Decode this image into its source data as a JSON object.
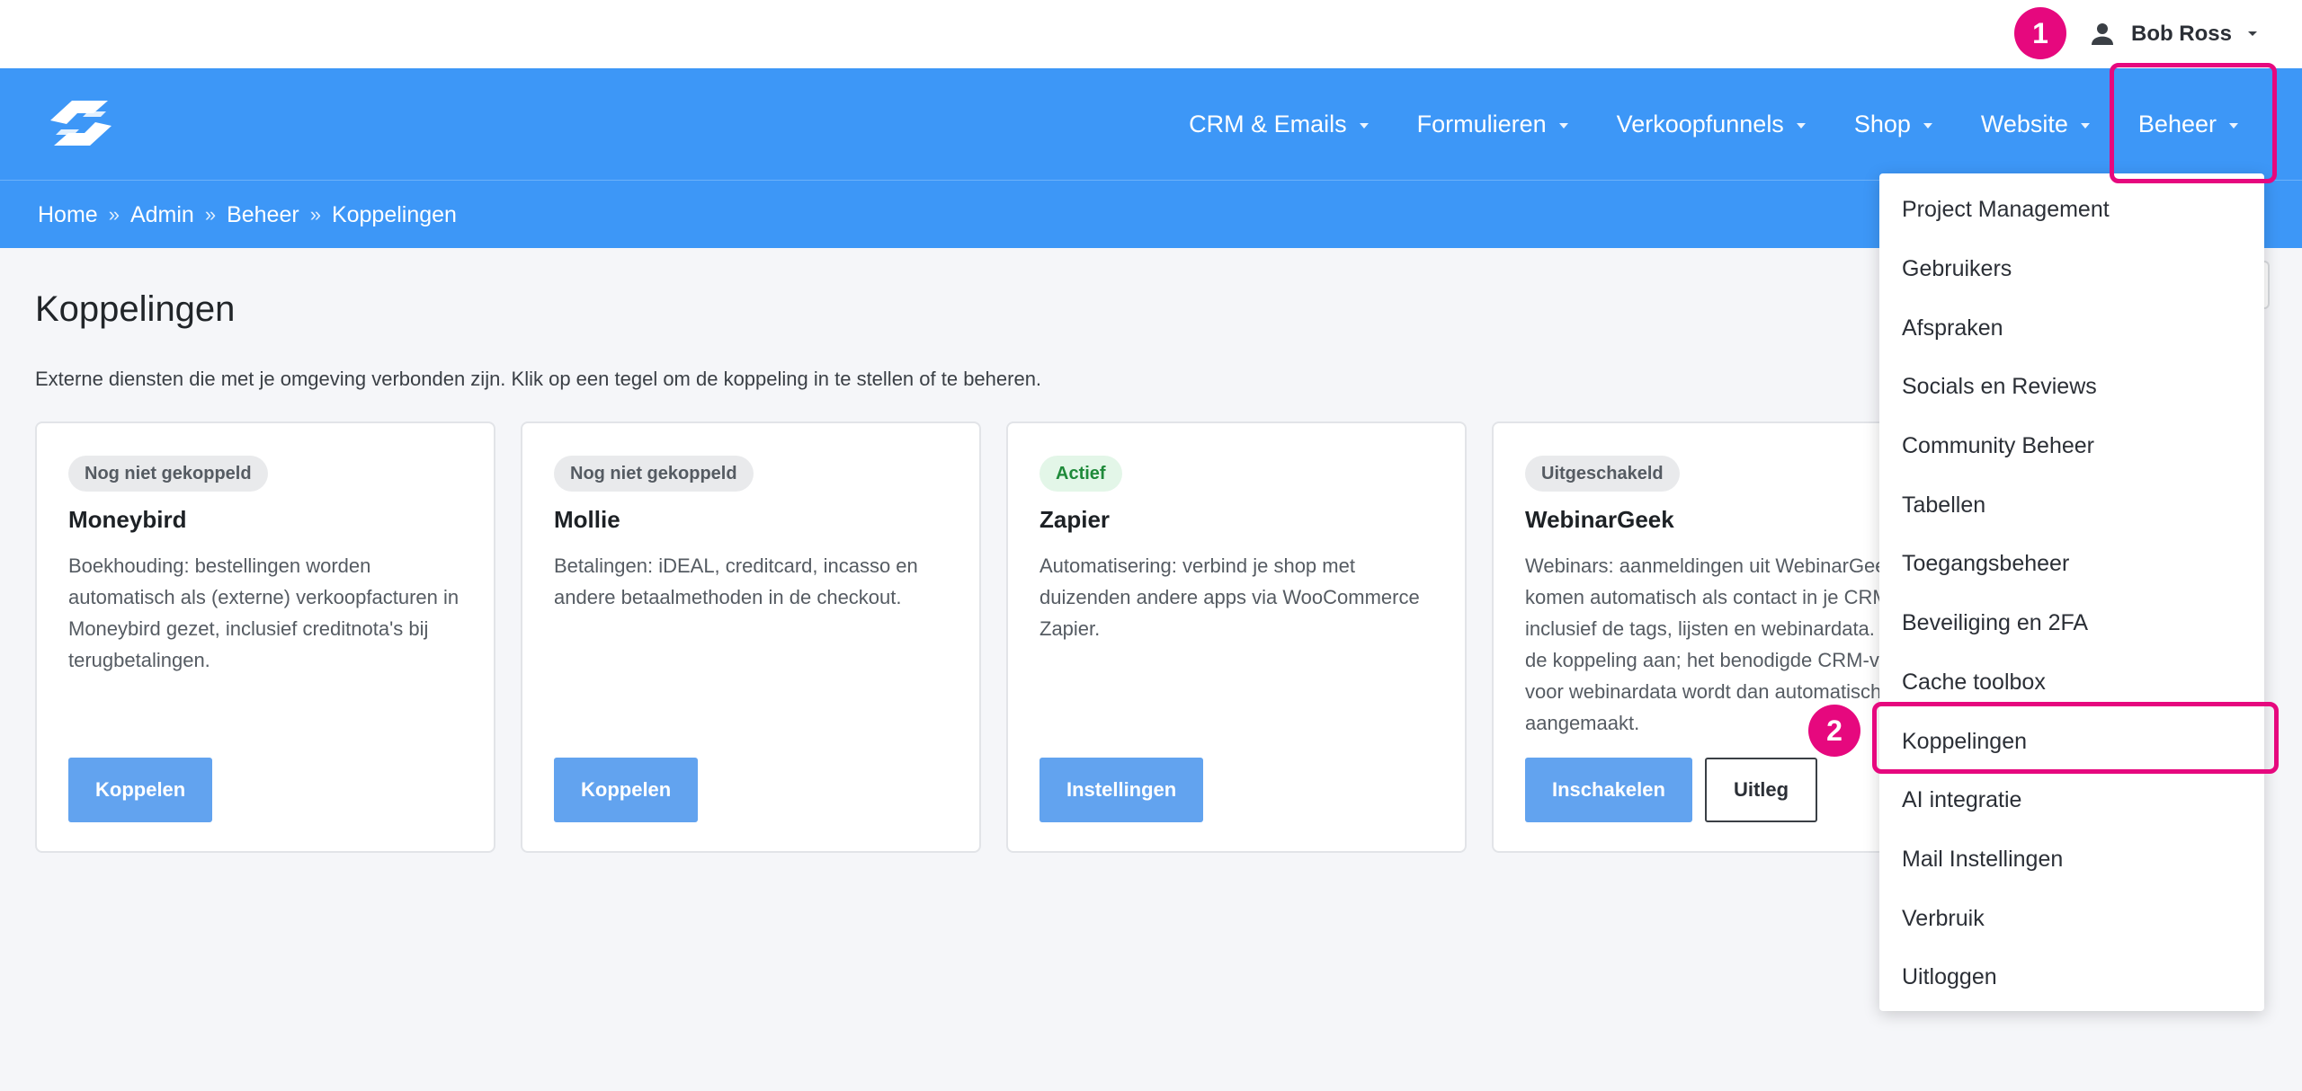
{
  "user": {
    "name": "Bob Ross"
  },
  "nav": {
    "items": [
      {
        "label": "CRM & Emails"
      },
      {
        "label": "Formulieren"
      },
      {
        "label": "Verkoopfunnels"
      },
      {
        "label": "Shop"
      },
      {
        "label": "Website"
      },
      {
        "label": "Beheer"
      }
    ]
  },
  "breadcrumb": {
    "items": [
      "Home",
      "Admin",
      "Beheer",
      "Koppelingen"
    ],
    "separator": "»"
  },
  "main": {
    "title": "Koppelingen",
    "description": "Externe diensten die met je omgeving verbonden zijn. Klik op een tegel om de koppeling in te stellen of te beheren."
  },
  "cards": [
    {
      "status": "Nog niet gekoppeld",
      "title": "Moneybird",
      "text": "Boekhouding: bestellingen worden automatisch als (externe) verkoopfacturen in Moneybird gezet, inclusief creditnota's bij terugbetalingen.",
      "primary_action": "Koppelen"
    },
    {
      "status": "Nog niet gekoppeld",
      "title": "Mollie",
      "text": "Betalingen: iDEAL, creditcard, incasso en andere betaalmethoden in de checkout.",
      "primary_action": "Koppelen"
    },
    {
      "status": "Actief",
      "title": "Zapier",
      "text": "Automatisering: verbind je shop met duizenden andere apps via WooCommerce Zapier.",
      "primary_action": "Instellingen"
    },
    {
      "status": "Uitgeschakeld",
      "title": "WebinarGeek",
      "text": "Webinars: aanmeldingen uit WebinarGeek komen automatisch als contact in je CRM, inclusief de tags, lijsten en webinardata. Zet de koppeling aan; het benodigde CRM-veld voor webinardata wordt dan automatisch aangemaakt.",
      "primary_action": "Inschakelen",
      "secondary_action": "Uitleg"
    }
  ],
  "dropdown": {
    "items": [
      "Project Management",
      "Gebruikers",
      "Afspraken",
      "Socials en Reviews",
      "Community Beheer",
      "Tabellen",
      "Toegangsbeheer",
      "Beveiliging en 2FA",
      "Cache toolbox",
      "Koppelingen",
      "AI integratie",
      "Mail Instellingen",
      "Verbruik",
      "Uitloggen"
    ]
  },
  "annotations": {
    "step1": "1",
    "step2": "2"
  },
  "colors": {
    "primary": "#3d97f7",
    "button": "#62a3ef",
    "highlight": "#e6087e"
  },
  "icons": [
    "user-icon",
    "caret-down-icon",
    "logo-icon"
  ]
}
